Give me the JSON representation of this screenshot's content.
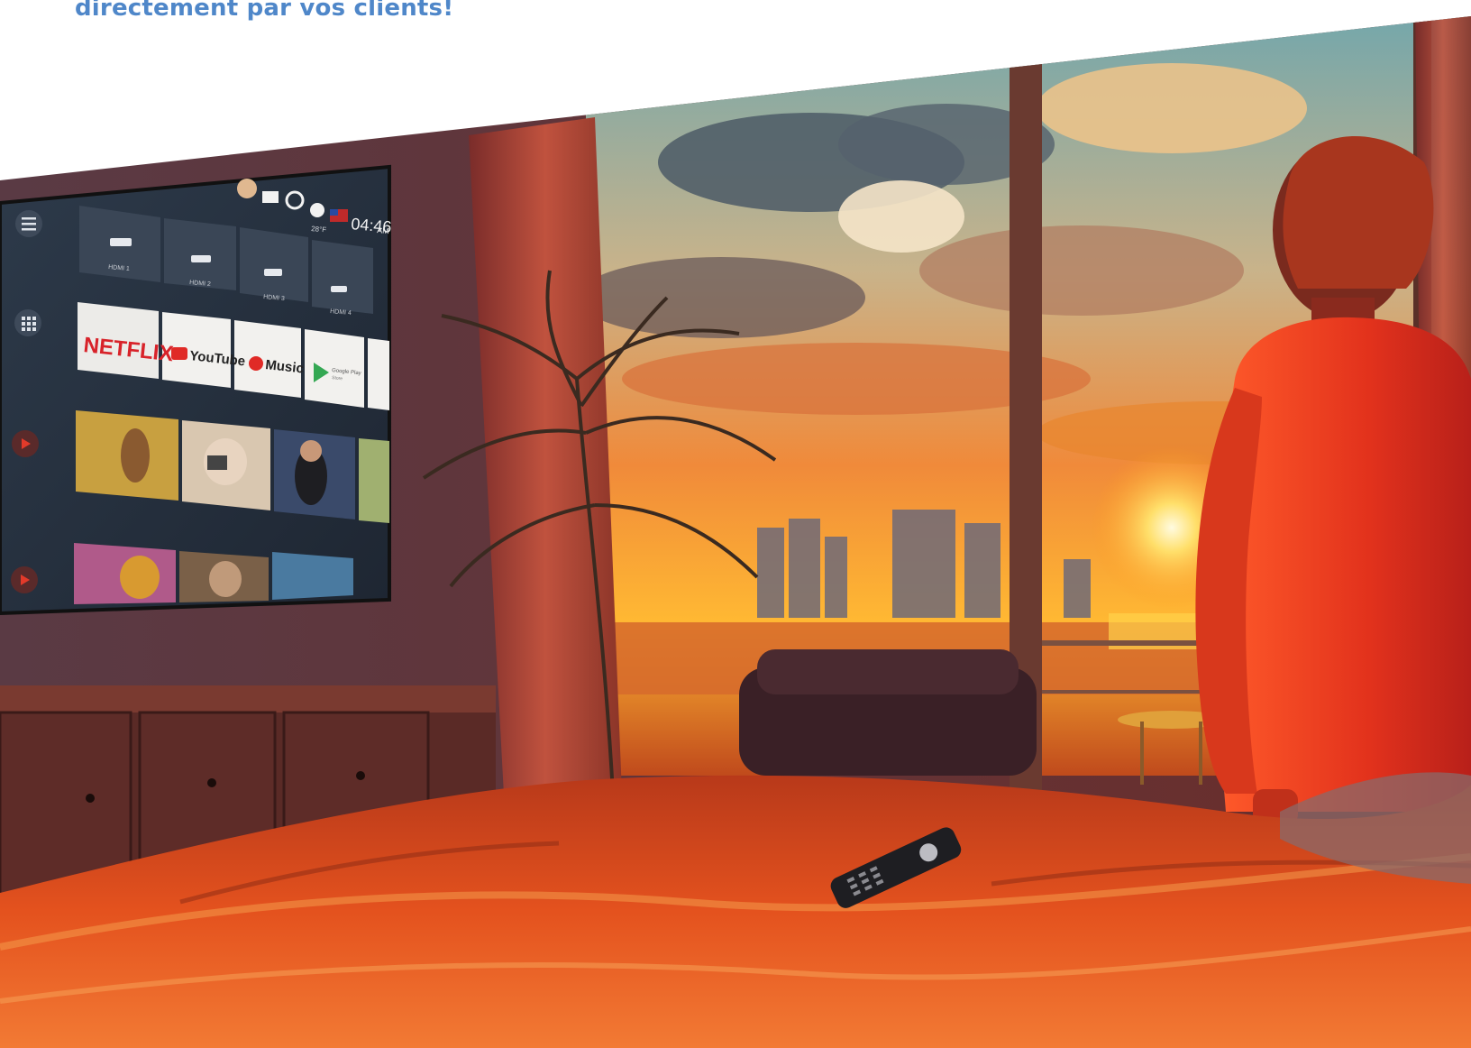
{
  "headline": {
    "text": "directement par vos clients!",
    "color": "#4f87c9"
  },
  "tv": {
    "status": {
      "time": "04:46",
      "ampm": "AM",
      "temperature": "28°F"
    },
    "inputs": [
      "HDMI 1",
      "HDMI 2",
      "HDMI 3",
      "HDMI 4"
    ],
    "apps": [
      "NETFLIX",
      "YouTube",
      "Music",
      "Google Play",
      "Store"
    ],
    "icons": [
      "menu-icon",
      "apps-grid-icon",
      "youtube-icon",
      "mail-icon",
      "alarm-icon",
      "weather-icon",
      "flag-icon",
      "avatar-icon"
    ]
  },
  "colors": {
    "sunset": "#ff8a1c",
    "sky": "#7fb3b8",
    "bed": "#e2471a",
    "wall": "#4a2a32"
  }
}
